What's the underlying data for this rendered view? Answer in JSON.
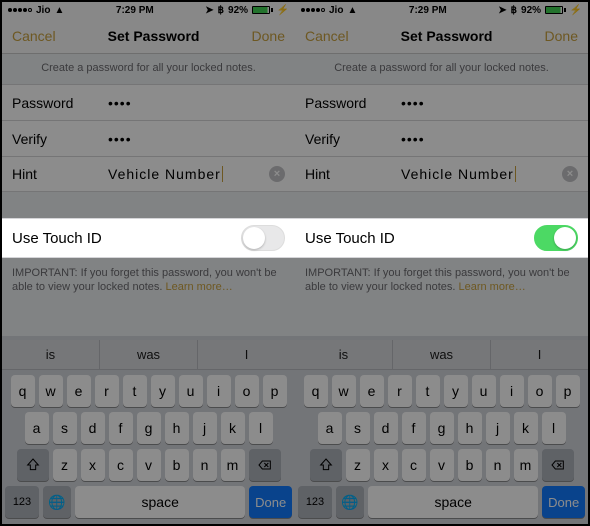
{
  "statusbar": {
    "carrier": "Jio",
    "time": "7:29 PM",
    "battery_pct": "92%"
  },
  "navbar": {
    "cancel": "Cancel",
    "title": "Set Password",
    "done": "Done"
  },
  "subtitle": "Create a password for all your locked notes.",
  "rows": {
    "password_label": "Password",
    "password_value": "••••",
    "verify_label": "Verify",
    "verify_value": "••••",
    "hint_label": "Hint",
    "hint_value": "Vehicle Number"
  },
  "touchid": {
    "label": "Use Touch ID"
  },
  "important": {
    "prefix": "IMPORTANT: ",
    "body": "If you forget this password, you won't be able to view your locked notes. ",
    "learn": "Learn more…"
  },
  "suggestions": [
    "is",
    "was",
    "I"
  ],
  "keyboard": {
    "r1": [
      "q",
      "w",
      "e",
      "r",
      "t",
      "y",
      "u",
      "i",
      "o",
      "p"
    ],
    "r2": [
      "a",
      "s",
      "d",
      "f",
      "g",
      "h",
      "j",
      "k",
      "l"
    ],
    "r3": [
      "z",
      "x",
      "c",
      "v",
      "b",
      "n",
      "m"
    ],
    "num": "123",
    "space": "space",
    "done": "Done"
  }
}
